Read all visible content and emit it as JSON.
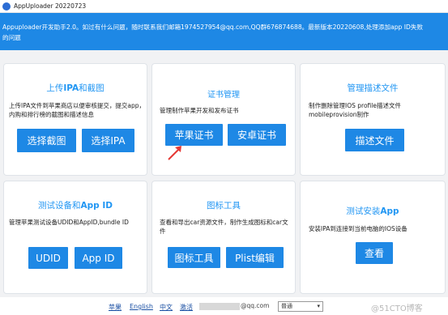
{
  "window": {
    "title": "AppUploader 20220723"
  },
  "banner": {
    "line1": "Appuploader开发助手2.0。如过有什么问题，随时联系我们邮箱1974527954@qq.com,QQ群676874688。最新版本20220608,处理添加app ID失败",
    "line2": "的问题"
  },
  "cards": {
    "upload_ipa": {
      "title_prefix": "上传",
      "title_bold": "IPA",
      "title_suffix": "和截图",
      "desc": "上传IPA文件到苹果商店以便审核提交，提交app，内购和排行榜的截图和描述信息",
      "btn_screenshot": "选择截图",
      "btn_ipa": "选择IPA"
    },
    "cert_manage": {
      "title": "证书管理",
      "desc": "管理制作苹果开发和发布证书",
      "btn_apple": "苹果证书",
      "btn_android": "安卓证书"
    },
    "profile_manage": {
      "title": "管理描述文件",
      "desc": "制作删除管理IOS profile描述文件mobileprovision制作",
      "btn_profile": "描述文件"
    },
    "device_appid": {
      "title_prefix": "测试设备和",
      "title_bold": "App ID",
      "desc": "管理苹果测试设备UDID和AppID,bundle ID",
      "btn_udid": "UDID",
      "btn_appid": "App ID"
    },
    "icon_tool": {
      "title": "图标工具",
      "desc": "查看和导出car资源文件，制作生成图标和car文件",
      "btn_icon": "图标工具",
      "btn_plist": "Plist编辑"
    },
    "test_install": {
      "title_prefix": "测试安装",
      "title_bold": "App",
      "desc": "安装IPA到连接到当前电脑的IOS设备",
      "btn_view": "查看"
    }
  },
  "footer": {
    "links": [
      "苹果",
      "English",
      "中文",
      "激活"
    ],
    "email_suffix": "@qq.com",
    "lang_select_value": "普通",
    "watermark": "@51CTO博客"
  },
  "colors": {
    "accent": "#1e88e5",
    "title_blue": "#2196f3",
    "arrow": "#e53935"
  },
  "icons": {
    "app": "appuploader-logo-icon",
    "arrow": "red-pointer-arrow-icon",
    "select": "chevron-down-icon"
  }
}
